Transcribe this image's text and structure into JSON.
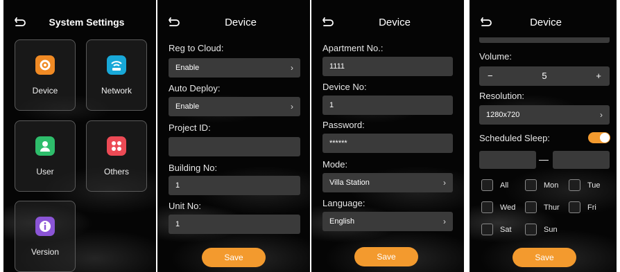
{
  "panels": {
    "system": {
      "title": "System Settings",
      "tiles": [
        {
          "label": "Device",
          "icon": "gear-icon",
          "color": "#f08a24"
        },
        {
          "label": "Network",
          "icon": "wifi-icon",
          "color": "#18a8d8"
        },
        {
          "label": "User",
          "icon": "user-icon",
          "color": "#2ebd6b"
        },
        {
          "label": "Others",
          "icon": "grid-icon",
          "color": "#ec4a55"
        },
        {
          "label": "Version",
          "icon": "info-icon",
          "color": "#8b55d6"
        }
      ]
    },
    "device1": {
      "title": "Device",
      "reg_to_cloud_label": "Reg to Cloud:",
      "reg_to_cloud_value": "Enable",
      "auto_deploy_label": "Auto Deploy:",
      "auto_deploy_value": "Enable",
      "project_id_label": "Project ID:",
      "project_id_value": "",
      "building_no_label": "Building No:",
      "building_no_value": "1",
      "unit_no_label": "Unit No:",
      "unit_no_value": "1",
      "save_label": "Save"
    },
    "device2": {
      "title": "Device",
      "apartment_label": "Apartment No.:",
      "apartment_value": "1111",
      "device_no_label": "Device No:",
      "device_no_value": "1",
      "password_label": "Password:",
      "password_value": "******",
      "mode_label": "Mode:",
      "mode_value": "Villa Station",
      "language_label": "Language:",
      "language_value": "English",
      "save_label": "Save"
    },
    "device3": {
      "title": "Device",
      "volume_label": "Volume:",
      "volume_minus": "−",
      "volume_value": "5",
      "volume_plus": "+",
      "resolution_label": "Resolution:",
      "resolution_value": "1280x720",
      "scheduled_sleep_label": "Scheduled Sleep:",
      "scheduled_sleep_on": true,
      "time_separator": "—",
      "days": [
        "All",
        "Mon",
        "Tue",
        "Wed",
        "Thur",
        "Fri",
        "Sat",
        "Sun"
      ],
      "save_label": "Save"
    }
  },
  "colors": {
    "accent": "#f39a2e",
    "field_bg": "#3a3a3a",
    "panel_bg": "#050505"
  }
}
